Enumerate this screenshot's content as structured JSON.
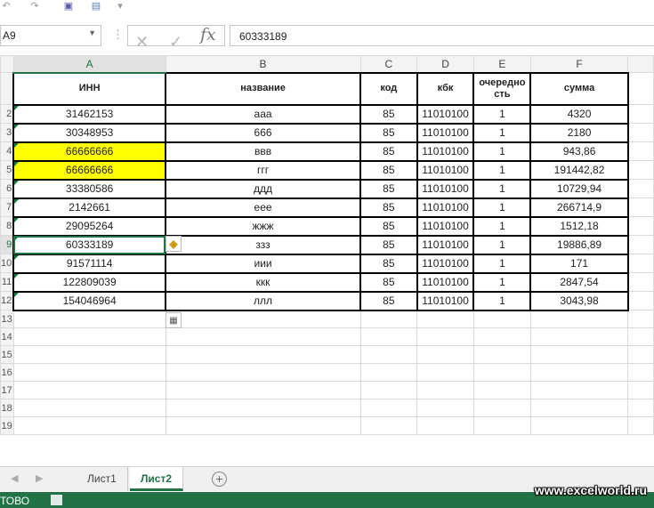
{
  "name_box": {
    "value": "A9"
  },
  "formula_bar": {
    "fx_label": "fx",
    "value": "60333189"
  },
  "columns": [
    "A",
    "B",
    "C",
    "D",
    "E",
    "F"
  ],
  "header_row": [
    "ИНН",
    "название",
    "код",
    "кбк",
    "очередно сть",
    "сумма"
  ],
  "row_labels": [
    "2",
    "3",
    "4",
    "5",
    "6",
    "7",
    "8",
    "9",
    "10",
    "11",
    "12",
    "13",
    "14",
    "15",
    "16",
    "17",
    "18",
    "19"
  ],
  "rows": [
    [
      "31462153",
      "ааа",
      "85",
      "11010100",
      "1",
      "4320"
    ],
    [
      "30348953",
      "666",
      "85",
      "11010100",
      "1",
      "2180"
    ],
    [
      "66666666",
      "ввв",
      "85",
      "11010100",
      "1",
      "943,86"
    ],
    [
      "66666666",
      "ггг",
      "85",
      "11010100",
      "1",
      "191442,82"
    ],
    [
      "33380586",
      "ддд",
      "85",
      "11010100",
      "1",
      "10729,94"
    ],
    [
      "2142661",
      "еее",
      "85",
      "11010100",
      "1",
      "266714,9"
    ],
    [
      "29095264",
      "жжж",
      "85",
      "11010100",
      "1",
      "1512,18"
    ],
    [
      "60333189",
      "ззз",
      "85",
      "11010100",
      "1",
      "19886,89"
    ],
    [
      "91571114",
      "иии",
      "85",
      "11010100",
      "1",
      "171"
    ],
    [
      "122809039",
      "ккк",
      "85",
      "11010100",
      "1",
      "2847,54"
    ],
    [
      "154046964",
      "ллл",
      "85",
      "11010100",
      "1",
      "3043,98"
    ]
  ],
  "highlight_color": "#ffff00",
  "accent_color": "#217346",
  "tabs": {
    "sheet1": "Лист1",
    "sheet2": "Лист2"
  },
  "status": {
    "text": "ТОВО"
  },
  "watermark": "www.excelworld.ru",
  "icons": [
    "undo-icon",
    "redo-icon",
    "save-icon",
    "cancel-icon",
    "enter-icon",
    "warning-icon",
    "paste-options-icon",
    "add-sheet-icon"
  ]
}
